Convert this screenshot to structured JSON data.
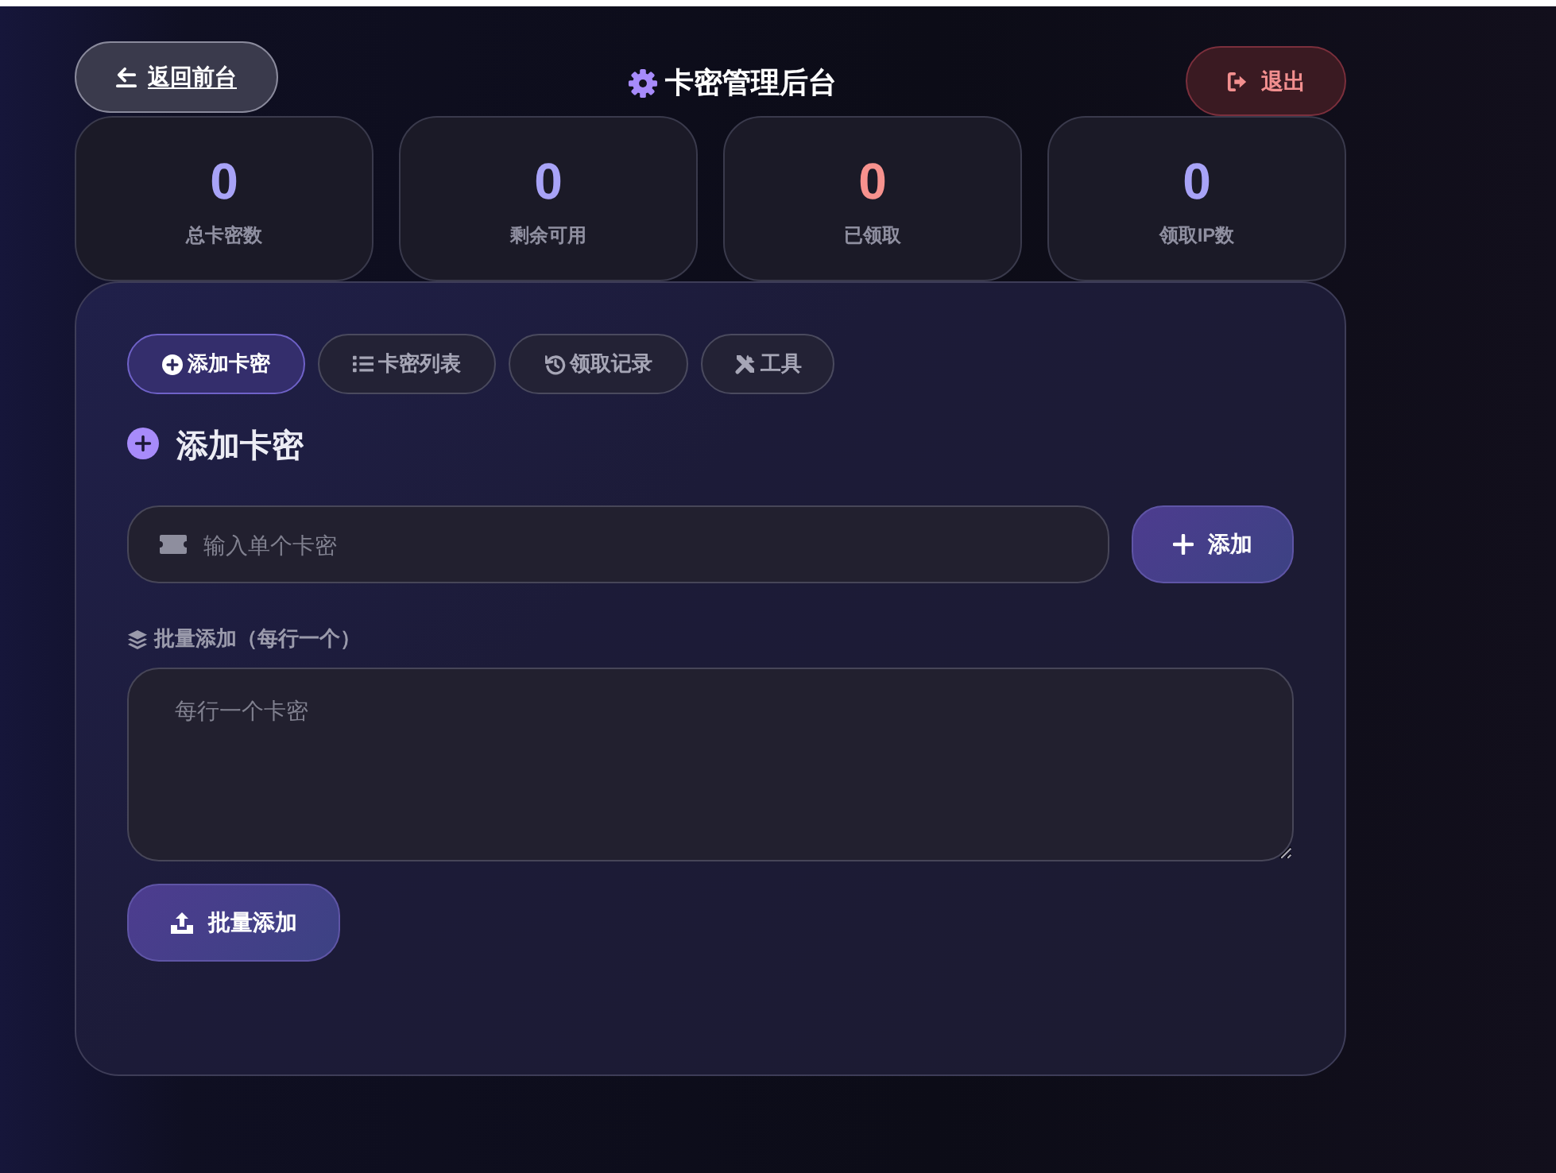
{
  "header": {
    "back_link": "返回前台",
    "title": "卡密管理后台",
    "logout_button": "退出"
  },
  "stats": [
    {
      "value": "0",
      "label": "总卡密数",
      "color": "#a8a3f7"
    },
    {
      "value": "0",
      "label": "剩余可用",
      "color": "#a8a3f7"
    },
    {
      "value": "0",
      "label": "已领取",
      "color": "#f7928e"
    },
    {
      "value": "0",
      "label": "领取IP数",
      "color": "#a8a3f7"
    }
  ],
  "tabs": [
    {
      "label": "添加卡密",
      "selected": true
    },
    {
      "label": "卡密列表",
      "selected": false
    },
    {
      "label": "领取记录",
      "selected": false
    },
    {
      "label": "工具",
      "selected": false
    }
  ],
  "section": {
    "title": "添加卡密"
  },
  "single_add": {
    "placeholder": "输入单个卡密",
    "button": "添加"
  },
  "batch_add": {
    "label": "批量添加（每行一个）",
    "placeholder": "每行一个卡密",
    "button": "批量添加"
  }
}
